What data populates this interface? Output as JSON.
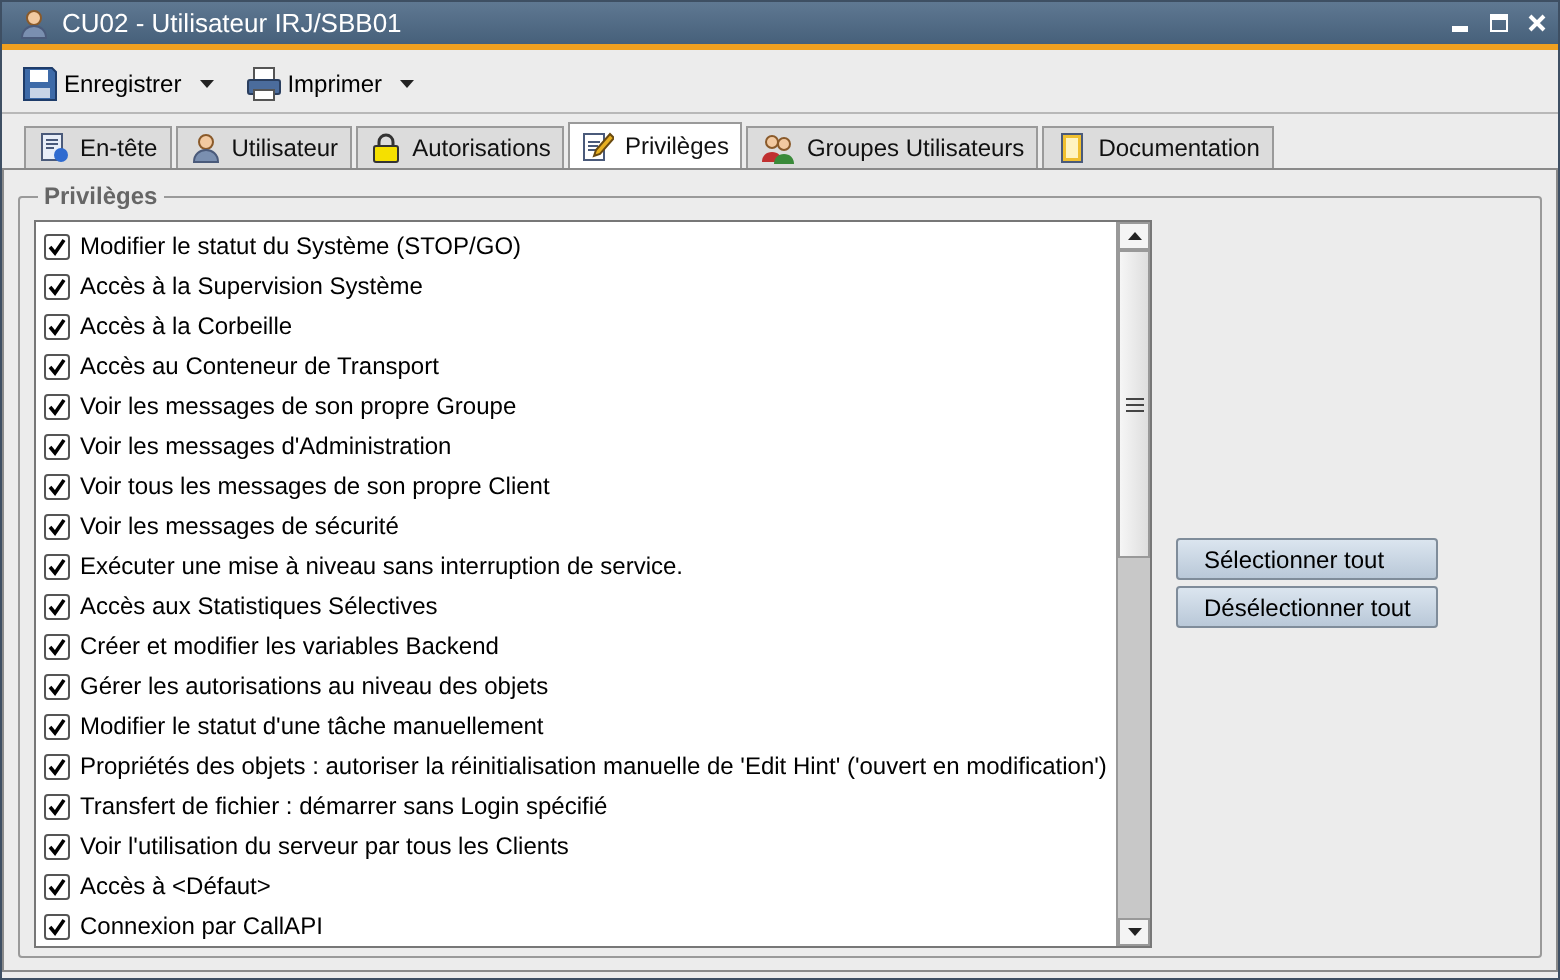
{
  "window": {
    "title": "CU02 - Utilisateur IRJ/SBB01"
  },
  "toolbar": [
    {
      "label": "Enregistrer",
      "kind": "save"
    },
    {
      "label": "Imprimer",
      "kind": "print"
    }
  ],
  "tabs": [
    {
      "label": "En-tête",
      "selected": false
    },
    {
      "label": "Utilisateur",
      "selected": false
    },
    {
      "label": "Autorisations",
      "selected": false
    },
    {
      "label": "Privilèges",
      "selected": true
    },
    {
      "label": "Groupes Utilisateurs",
      "selected": false
    },
    {
      "label": "Documentation",
      "selected": false
    }
  ],
  "privileges": {
    "title": "Privilèges",
    "items": [
      {
        "label": "Modifier le statut du Système (STOP/GO)",
        "checked": true
      },
      {
        "label": "Accès à la Supervision Système",
        "checked": true
      },
      {
        "label": "Accès à la Corbeille",
        "checked": true
      },
      {
        "label": "Accès au Conteneur de Transport",
        "checked": true
      },
      {
        "label": "Voir les messages de son propre Groupe",
        "checked": true
      },
      {
        "label": "Voir les messages d'Administration",
        "checked": true
      },
      {
        "label": "Voir tous les messages de son propre Client",
        "checked": true
      },
      {
        "label": "Voir les messages de sécurité",
        "checked": true
      },
      {
        "label": "Exécuter une mise à niveau sans interruption de service.",
        "checked": true
      },
      {
        "label": "Accès aux Statistiques Sélectives",
        "checked": true
      },
      {
        "label": "Créer et modifier les variables Backend",
        "checked": true
      },
      {
        "label": "Gérer les autorisations au niveau des objets",
        "checked": true
      },
      {
        "label": "Modifier le statut d'une tâche manuellement",
        "checked": true
      },
      {
        "label": "Propriétés des objets : autoriser la réinitialisation manuelle de 'Edit Hint' ('ouvert en modification')",
        "checked": true
      },
      {
        "label": "Transfert de fichier : démarrer sans Login spécifié",
        "checked": true
      },
      {
        "label": "Voir l'utilisation du serveur par tous les Clients",
        "checked": true
      },
      {
        "label": "Accès à <Défaut>",
        "checked": true
      },
      {
        "label": "Connexion par CallAPI",
        "checked": true
      }
    ]
  },
  "buttons": [
    "Sélectionner tout",
    "Désélectionner tout"
  ]
}
